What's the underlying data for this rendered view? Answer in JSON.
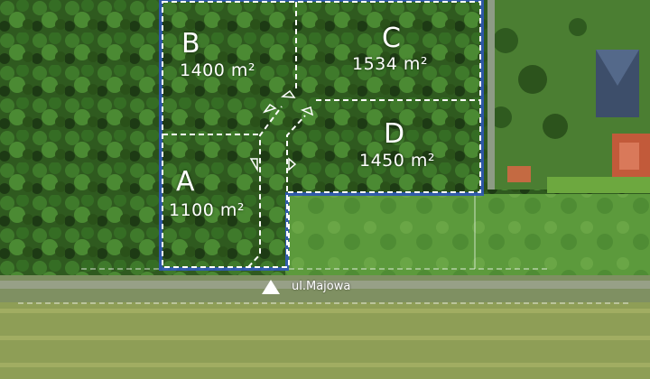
{
  "plots": [
    {
      "id": "A",
      "letter": "A",
      "area": "1100 m²"
    },
    {
      "id": "B",
      "letter": "B",
      "area": "1400 m²"
    },
    {
      "id": "C",
      "letter": "C",
      "area": "1534 m²"
    },
    {
      "id": "D",
      "letter": "D",
      "area": "1450 m²"
    }
  ],
  "street": {
    "label": "ul.Majowa",
    "marker_icon": "access-arrow-icon"
  },
  "colors": {
    "plot_outline": "#2f56b5",
    "divider": "#ffffff",
    "field": "#8f9f56",
    "road": "#97a087"
  }
}
